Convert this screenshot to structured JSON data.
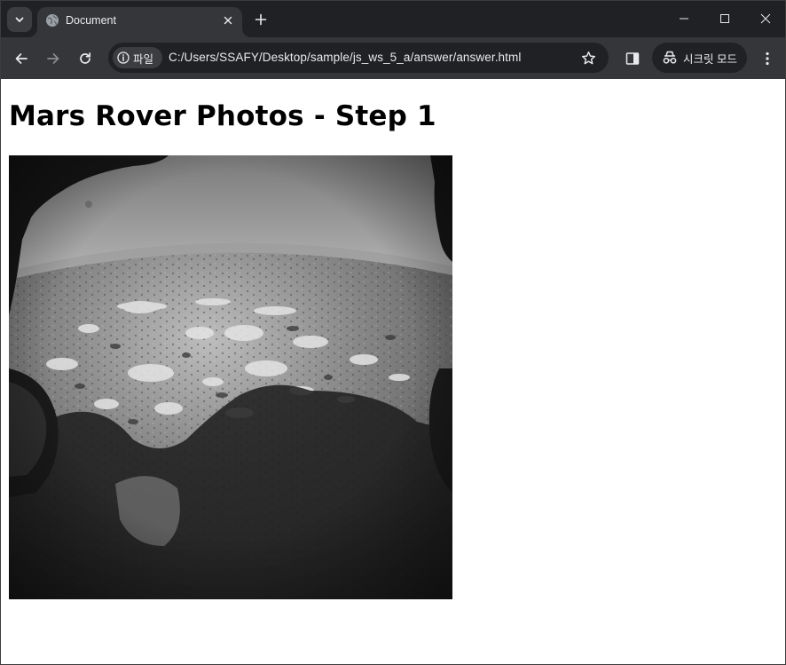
{
  "browser": {
    "tab": {
      "title": "Document",
      "favicon": "globe-icon"
    },
    "toolbar": {
      "site_chip_label": "파일",
      "url": "C:/Users/SSAFY/Desktop/sample/js_ws_5_a/answer/answer.html",
      "incognito_label": "시크릿 모드"
    },
    "icons": {
      "tab_search": "chevron-down-icon",
      "tab_close": "close-icon",
      "new_tab": "plus-icon",
      "minimize": "minimize-icon",
      "maximize": "maximize-icon",
      "close": "close-icon",
      "back": "arrow-left-icon",
      "forward": "arrow-right-icon",
      "reload": "reload-icon",
      "info": "info-icon",
      "bookmark": "star-icon",
      "side_panel": "side-panel-icon",
      "incognito": "incognito-icon",
      "menu": "kebab-menu-icon"
    },
    "colors": {
      "tabstrip": "#202124",
      "toolbar": "#35363a",
      "text": "#e8eaed"
    }
  },
  "page": {
    "heading": "Mars Rover Photos - Step 1",
    "photo": {
      "kind": "grayscale mars surface photograph"
    }
  }
}
